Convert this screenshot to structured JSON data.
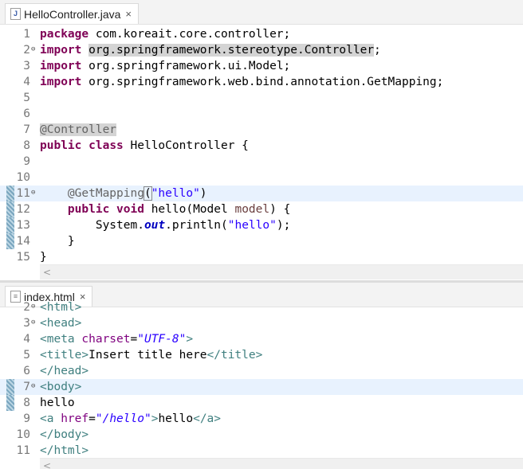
{
  "java_editor": {
    "tab_title": "HelloController.java",
    "tab_close": "×",
    "tab_icon": "J",
    "lines": [
      {
        "n": "1",
        "html": "<span class=\"kw\">package</span> com.koreait.core.controller;"
      },
      {
        "n": "2",
        "fold": "⊖",
        "html": "<span class=\"kw\">import</span> <span class=\"sel\">org.springframework.stereotype.Controller</span>;"
      },
      {
        "n": "3",
        "html": "<span class=\"kw\">import</span> org.springframework.ui.Model;"
      },
      {
        "n": "4",
        "html": "<span class=\"kw\">import</span> org.springframework.web.bind.annotation.GetMapping;"
      },
      {
        "n": "5",
        "html": ""
      },
      {
        "n": "6",
        "html": ""
      },
      {
        "n": "7",
        "html": "<span class=\"ann sel\">@Controller</span>"
      },
      {
        "n": "8",
        "html": "<span class=\"kw\">public</span> <span class=\"kw\">class</span> HelloController {"
      },
      {
        "n": "9",
        "html": ""
      },
      {
        "n": "10",
        "html": ""
      },
      {
        "n": "11",
        "fold": "⊖",
        "mark": true,
        "hl": true,
        "html": "    <span class=\"ann\">@GetMapping</span><span class=\"bracket\">(</span><span class=\"str\">\"hello\"</span>)"
      },
      {
        "n": "12",
        "mark": true,
        "html": "    <span class=\"kw\">public</span> <span class=\"kw\">void</span> hello(Model <span class=\"param\">model</span>) {"
      },
      {
        "n": "13",
        "mark": true,
        "html": "        System.<span class=\"static\">out</span>.println(<span class=\"str\">\"hello\"</span>);"
      },
      {
        "n": "14",
        "mark": true,
        "html": "    }"
      },
      {
        "n": "15",
        "html": "}"
      }
    ]
  },
  "html_editor": {
    "tab_title": "index.html",
    "tab_close": "×",
    "lines": [
      {
        "n": "2",
        "fold": "⊖",
        "html": "<span class=\"tag\">&lt;html&gt;</span>"
      },
      {
        "n": "3",
        "fold": "⊖",
        "html": "<span class=\"tag\">&lt;head&gt;</span>"
      },
      {
        "n": "4",
        "html": "<span class=\"tag\">&lt;meta</span> <span class=\"attr\">charset</span>=<span class=\"aval\">\"UTF-8\"</span><span class=\"tag\">&gt;</span>"
      },
      {
        "n": "5",
        "html": "<span class=\"tag\">&lt;title&gt;</span>Insert title here<span class=\"tag\">&lt;/title&gt;</span>"
      },
      {
        "n": "6",
        "html": "<span class=\"tag\">&lt;/head&gt;</span>"
      },
      {
        "n": "7",
        "fold": "⊖",
        "mark": true,
        "hl": true,
        "html": "<span class=\"tag\">&lt;body&gt;</span>"
      },
      {
        "n": "8",
        "mark": true,
        "html": "hello"
      },
      {
        "n": "9",
        "html": "<span class=\"tag\">&lt;a</span> <span class=\"attr\">href</span>=<span class=\"aval\">\"/hello\"</span><span class=\"tag\">&gt;</span>hello<span class=\"tag\">&lt;/a&gt;</span>"
      },
      {
        "n": "10",
        "html": "<span class=\"tag\">&lt;/body&gt;</span>"
      },
      {
        "n": "11",
        "html": "<span class=\"tag\">&lt;/html&gt;</span>"
      }
    ]
  },
  "scroll_arrow": "<"
}
